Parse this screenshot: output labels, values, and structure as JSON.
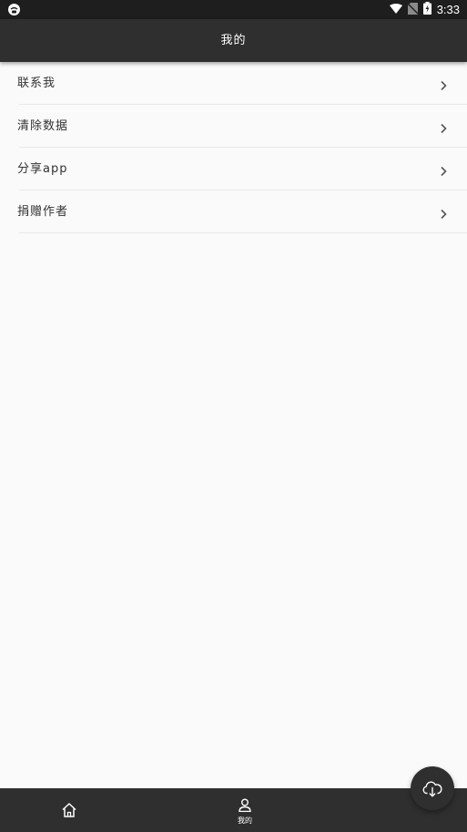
{
  "status_bar": {
    "time": "3:33",
    "left_icon": "app-notification-icon",
    "icons": [
      "wifi-icon",
      "no-sim-icon",
      "battery-charging-icon"
    ]
  },
  "app_bar": {
    "title": "我的"
  },
  "menu": {
    "items": [
      {
        "label": "联系我",
        "icon": "chevron-right-icon"
      },
      {
        "label": "清除数据",
        "icon": "chevron-right-icon"
      },
      {
        "label": "分享app",
        "icon": "chevron-right-icon"
      },
      {
        "label": "捐赠作者",
        "icon": "chevron-right-icon"
      }
    ]
  },
  "bottom_nav": {
    "items": [
      {
        "label": "",
        "icon": "home-icon",
        "selected": false
      },
      {
        "label": "我的",
        "icon": "person-icon",
        "selected": true
      }
    ]
  },
  "fab": {
    "icon": "cloud-download-icon"
  },
  "colors": {
    "app_bar": "#2f2f2f",
    "status_bar": "#1e1e1e",
    "background": "#fafafa",
    "text_primary": "#333333",
    "divider": "#e8e8e8"
  }
}
